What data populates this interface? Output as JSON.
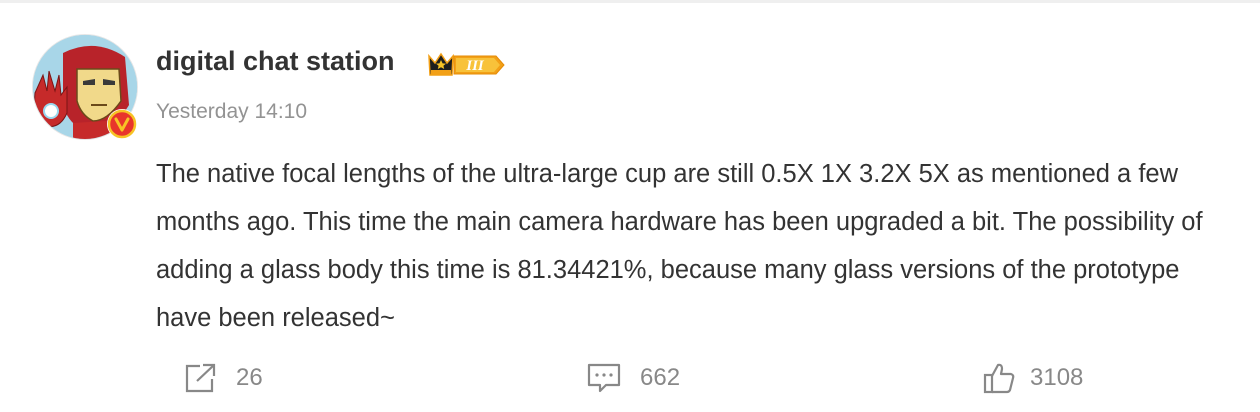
{
  "post": {
    "author": "digital chat station",
    "time": "Yesterday 14:10",
    "text": "The native focal lengths of the ultra-large cup are still 0.5X 1X 3.2X 5X as mentioned a few months ago. This time the main camera hardware has been upgraded a bit. The possibility of adding a glass body this time is 81.34421%, because many glass versions of the prototype have been released~",
    "level_badge": "III"
  },
  "actions": {
    "shares": "26",
    "comments": "662",
    "likes": "3108"
  },
  "colors": {
    "text": "#333333",
    "muted": "#939393",
    "badge_orange": "#f2a017",
    "verified_red": "#e8352b",
    "verified_yellow": "#f7c325"
  },
  "icons": {
    "share": "share-icon",
    "comment": "comment-icon",
    "like": "thumbs-up-icon",
    "verified": "verified-v-icon",
    "crown": "crown-icon"
  }
}
